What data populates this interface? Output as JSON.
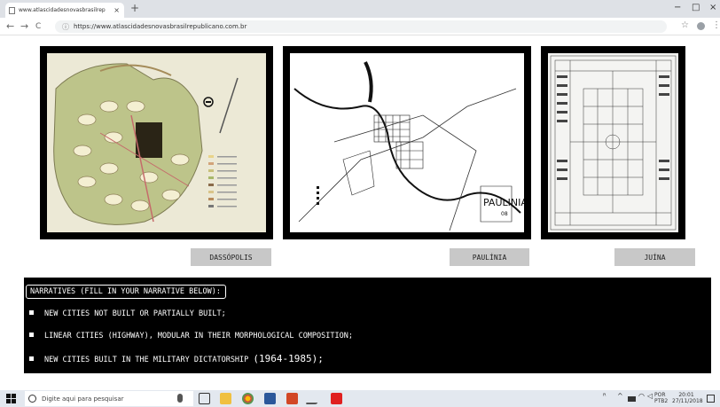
{
  "browser": {
    "tab_title": "www.atlascidadesnovasbrasilrep",
    "tab_close": "×",
    "new_tab": "+",
    "minimize": "−",
    "maximize": "□",
    "close": "×",
    "back": "←",
    "forward": "→",
    "reload": "C",
    "url": "https://www.atlascidadesnovasbrasilrepublicano.com.br",
    "star": "☆",
    "menu": "⋮"
  },
  "gallery": [
    {
      "caption": "DASSÓPOLIS",
      "icon": "city-plan-image"
    },
    {
      "caption": "PAULÍNIA",
      "icon": "city-map-image",
      "map_label": "PAULINIA",
      "map_number": "08"
    },
    {
      "caption": "JUÍNA",
      "icon": "city-grid-plan-image"
    }
  ],
  "narratives": {
    "title": "NARRATIVES (FILL IN YOUR NARRATIVE BELOW):",
    "items": [
      {
        "text": "NEW CITIES NOT BUILT OR PARTIALLY BUILT;"
      },
      {
        "text": "LINEAR CITIES (HIGHWAY), MODULAR IN THEIR MORPHOLOGICAL COMPOSITION;"
      },
      {
        "text": "NEW CITIES BUILT IN THE MILITARY DICTATORSHIP",
        "years": "(1964-1985);"
      }
    ]
  },
  "taskbar": {
    "search_placeholder": "Digite aqui para pesquisar",
    "lang_top": "POR",
    "lang_bottom": "PTB2",
    "time": "20:01",
    "date": "27/11/2018"
  }
}
